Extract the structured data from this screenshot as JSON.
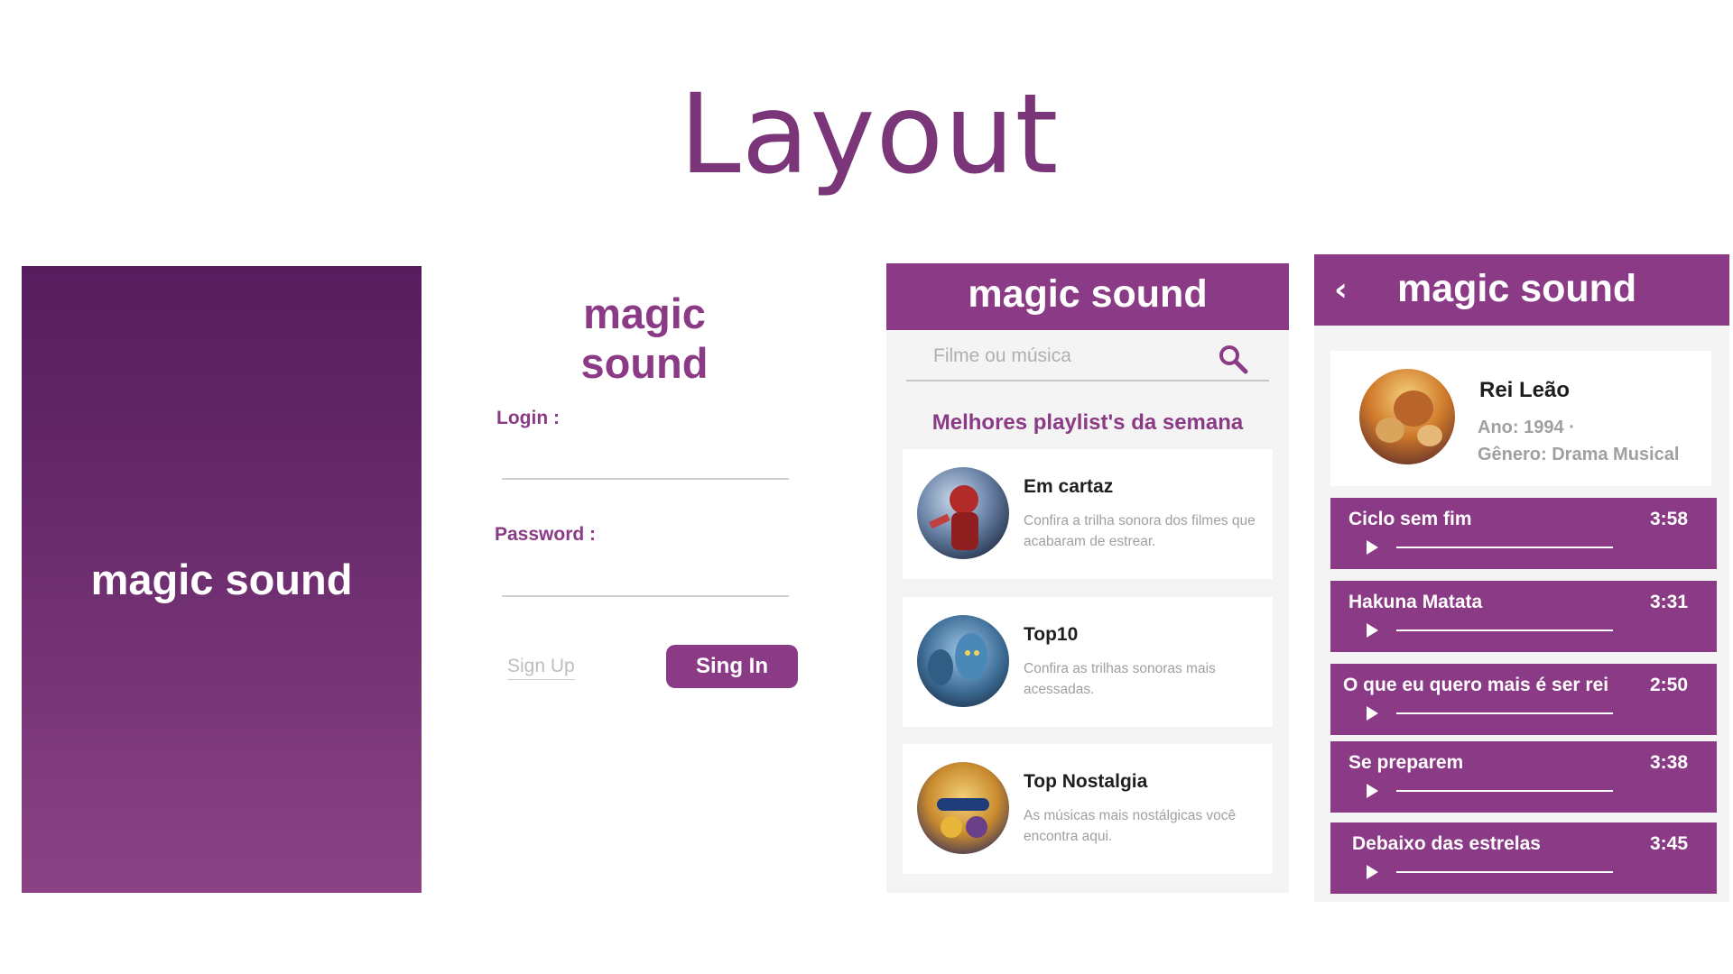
{
  "page": {
    "title": "Layout"
  },
  "splash": {
    "brand": "magic sound"
  },
  "login": {
    "brand": "magic sound",
    "login_label": "Login :",
    "password_label": "Password :",
    "signup_label": "Sign Up",
    "signin_label": "Sing In"
  },
  "home": {
    "brand": "magic sound",
    "search_placeholder": "Filme ou música",
    "section_title": "Melhores playlist's da semana",
    "playlists": [
      {
        "title": "Em cartaz",
        "desc": "Confira a trilha sonora dos filmes que acabaram de estrear."
      },
      {
        "title": "Top10",
        "desc": "Confira as trilhas sonoras mais acessadas."
      },
      {
        "title": "Top Nostalgia",
        "desc": "As músicas mais nostálgicas você encontra aqui."
      }
    ]
  },
  "detail": {
    "brand": "magic sound",
    "album": {
      "title": "Rei Leão",
      "year": "Ano: 1994 ·",
      "genre": "Gênero: Drama Musical"
    },
    "tracks": [
      {
        "name": "Ciclo sem  fim",
        "time": "3:58"
      },
      {
        "name": "Hakuna  Matata",
        "time": "3:31"
      },
      {
        "name": "O que eu quero mais é ser rei",
        "time": "2:50"
      },
      {
        "name": "Se preparem",
        "time": "3:38"
      },
      {
        "name": "Debaixo das estrelas",
        "time": "3:45"
      }
    ]
  },
  "colors": {
    "brand_purple": "#8b3a85",
    "splash_top": "#551d5d",
    "splash_bottom": "#8b4385",
    "title_purple": "#7b3679"
  }
}
